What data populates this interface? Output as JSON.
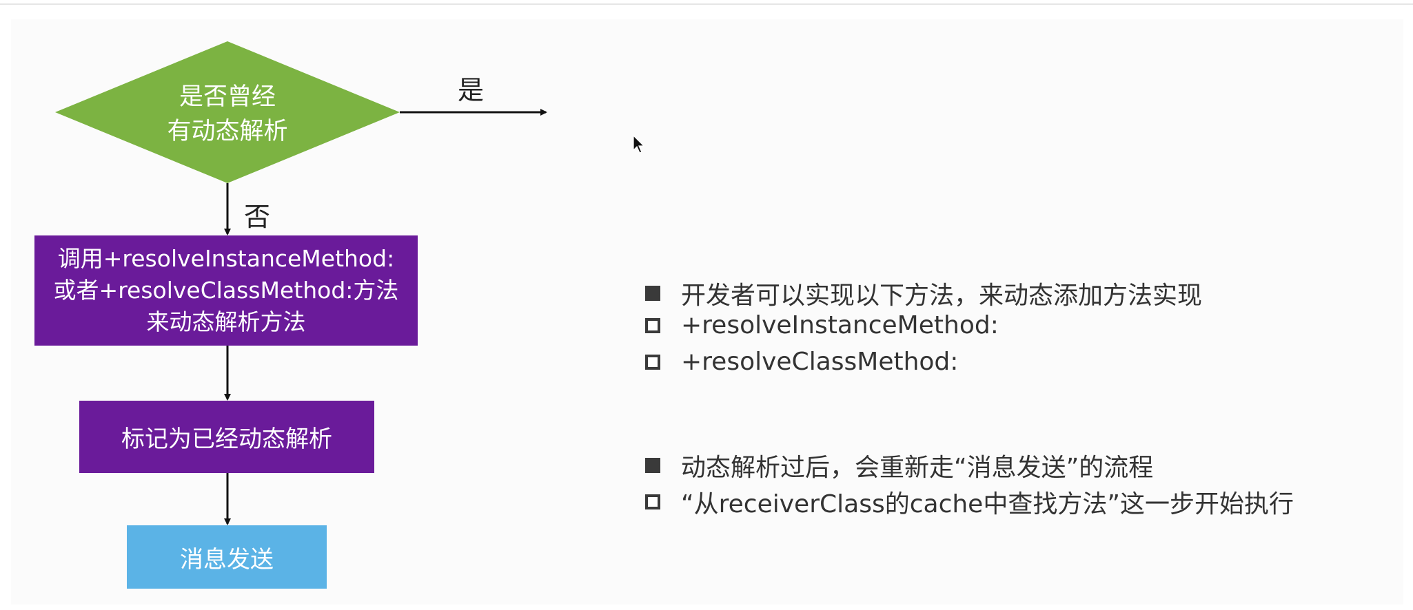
{
  "flowchart": {
    "decision": {
      "line1": "是否曾经",
      "line2": "有动态解析",
      "fill": "#7cb342"
    },
    "yes_label": "是",
    "no_label": "否",
    "resolve_step": {
      "line1": "调用+resolveInstanceMethod:",
      "line2": "或者+resolveClassMethod:方法",
      "line3": "来动态解析方法"
    },
    "mark_step": "标记为已经动态解析",
    "send_step": "消息发送",
    "colors": {
      "process": "#6a1b9a",
      "terminal": "#5bb3e6",
      "arrow": "#111111"
    }
  },
  "notes": [
    {
      "marker": "filled-square",
      "text": "开发者可以实现以下方法，来动态添加方法实现"
    },
    {
      "marker": "hollow-square",
      "text": "+resolveInstanceMethod:"
    },
    {
      "marker": "hollow-square",
      "text": "+resolveClassMethod:"
    },
    {
      "marker": "filled-square",
      "text": "动态解析过后，会重新走“消息发送”的流程"
    },
    {
      "marker": "hollow-square",
      "text": "“从receiverClass的cache中查找方法”这一步开始执行"
    }
  ],
  "cursor": {
    "icon": "mouse-pointer-icon"
  }
}
